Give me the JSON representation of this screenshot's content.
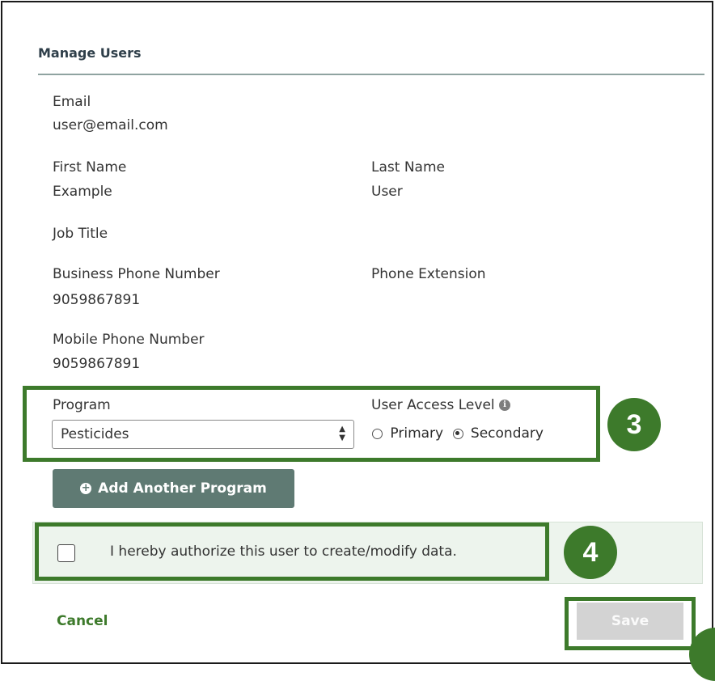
{
  "title": "Manage Users",
  "fields": {
    "email": {
      "label": "Email",
      "value": "user@email.com"
    },
    "first_name": {
      "label": "First Name",
      "value": "Example"
    },
    "last_name": {
      "label": "Last Name",
      "value": "User"
    },
    "job_title": {
      "label": "Job Title",
      "value": ""
    },
    "business_phone": {
      "label": "Business Phone Number",
      "value": "9059867891"
    },
    "phone_extension": {
      "label": "Phone Extension",
      "value": ""
    },
    "mobile_phone": {
      "label": "Mobile Phone Number",
      "value": "9059867891"
    }
  },
  "program": {
    "label": "Program",
    "selected": "Pesticides"
  },
  "access_level": {
    "label": "User Access Level",
    "options": [
      "Primary",
      "Secondary"
    ],
    "selected": "Secondary"
  },
  "add_program_label": "Add Another Program",
  "authorize_text": "I hereby authorize this user to create/modify data.",
  "authorize_checked": false,
  "cancel_label": "Cancel",
  "save_label": "Save",
  "callouts": {
    "step3": "3",
    "step4": "4"
  },
  "colors": {
    "accent": "#3d7a2b",
    "button": "#5f7a73",
    "panel": "#edf4ed",
    "save_disabled": "#d3d3d3"
  },
  "icons": {
    "info": "info-icon",
    "plus": "plus-circle-icon",
    "select_arrows": "chevron-up-down-icon"
  }
}
